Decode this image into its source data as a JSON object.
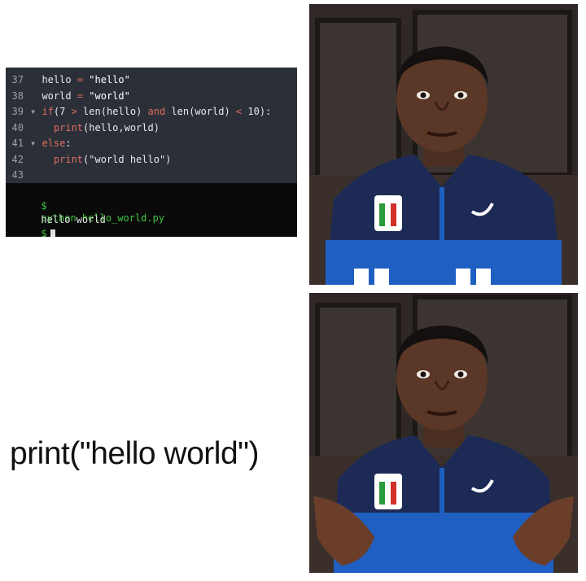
{
  "code": {
    "lines": [
      {
        "num": "37",
        "fold": "",
        "indent": "",
        "parts": [
          {
            "t": "hello ",
            "c": "plain"
          },
          {
            "t": "=",
            "c": "kw"
          },
          {
            "t": " \"hello\"",
            "c": "str"
          }
        ]
      },
      {
        "num": "38",
        "fold": "",
        "indent": "",
        "parts": [
          {
            "t": "world ",
            "c": "plain"
          },
          {
            "t": "=",
            "c": "kw"
          },
          {
            "t": " \"world\"",
            "c": "str"
          }
        ]
      },
      {
        "num": "39",
        "fold": "▾",
        "indent": "",
        "parts": [
          {
            "t": "if",
            "c": "kw"
          },
          {
            "t": "(7 ",
            "c": "plain"
          },
          {
            "t": ">",
            "c": "kw"
          },
          {
            "t": " len(hello) ",
            "c": "plain"
          },
          {
            "t": "and",
            "c": "kw"
          },
          {
            "t": " len(world) ",
            "c": "plain"
          },
          {
            "t": "<",
            "c": "kw"
          },
          {
            "t": " 10):",
            "c": "plain"
          }
        ]
      },
      {
        "num": "40",
        "fold": "",
        "indent": "  ",
        "parts": [
          {
            "t": "print",
            "c": "kw"
          },
          {
            "t": "(hello,world)",
            "c": "plain"
          }
        ]
      },
      {
        "num": "41",
        "fold": "▾",
        "indent": "",
        "parts": [
          {
            "t": "else",
            "c": "kw"
          },
          {
            "t": ":",
            "c": "plain"
          }
        ]
      },
      {
        "num": "42",
        "fold": "",
        "indent": "  ",
        "parts": [
          {
            "t": "print",
            "c": "kw"
          },
          {
            "t": "(\"world hello\")",
            "c": "plain"
          }
        ]
      },
      {
        "num": "43",
        "fold": "",
        "indent": "",
        "parts": []
      }
    ]
  },
  "terminal": {
    "prompt": "$",
    "command": "python hello_world.py",
    "output": "hello world",
    "prompt2": "$"
  },
  "caption": "print(\"hello world\")"
}
